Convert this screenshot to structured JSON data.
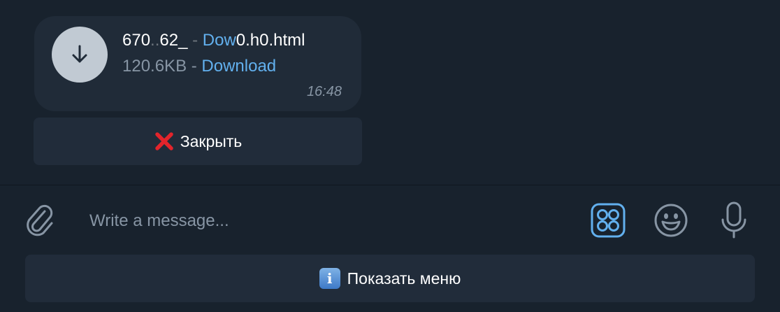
{
  "message": {
    "file_name_start": "670",
    "file_name_blur1": "..",
    "file_name_mid": "62_",
    "file_name_sep": " - ",
    "file_name_link": "Dow",
    "file_name_blur2": "",
    "file_name_end": "0.h0.html",
    "file_size": "120.6KB",
    "separator": " - ",
    "download_label": "Download",
    "time": "16:48"
  },
  "inline_button": {
    "label": "Закрыть",
    "icon": "red-cross-icon"
  },
  "composer": {
    "placeholder": "Write a message...",
    "attach_icon": "paperclip-icon",
    "apps_icon": "apps-grid-icon",
    "emoji_icon": "smiley-icon",
    "mic_icon": "microphone-icon"
  },
  "menu_button": {
    "label": "Показать меню",
    "icon": "info-icon"
  },
  "colors": {
    "background": "#18222d",
    "bubble": "#202b38",
    "button": "#212c3a",
    "accent": "#62b0ee",
    "muted": "#8795a4",
    "close_red": "#e3242b"
  }
}
